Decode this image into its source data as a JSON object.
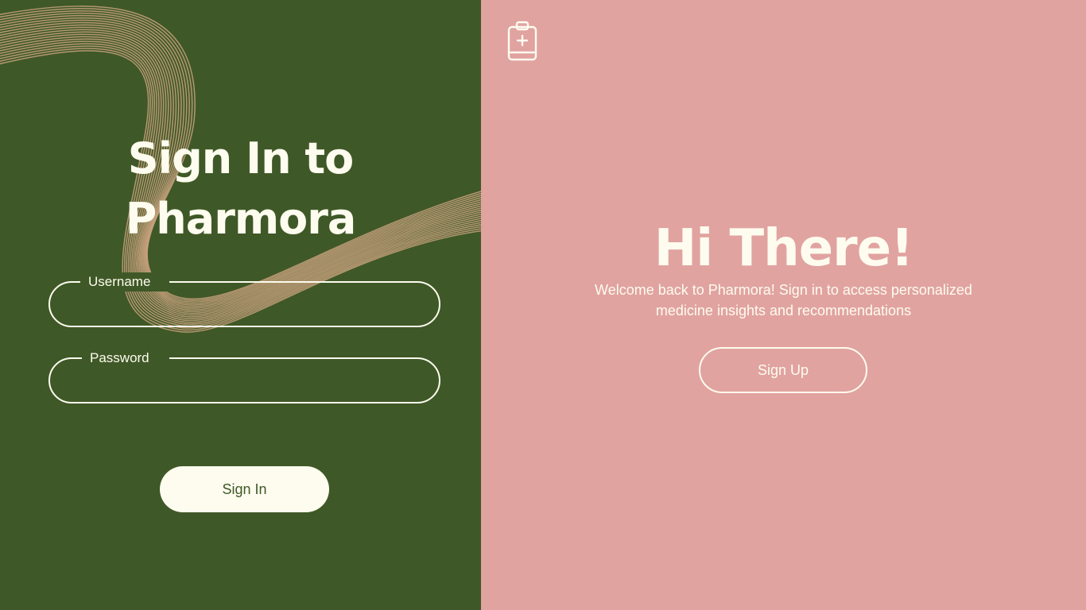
{
  "colors": {
    "left_background": "#3f5827",
    "right_background": "#e1a3a0",
    "text_light": "#fdfcef",
    "wave_lines": "#c9a27f"
  },
  "signin_panel": {
    "title_line1": "Sign In to",
    "title_line2": "Pharmora",
    "username": {
      "label": "Username",
      "value": "",
      "placeholder": ""
    },
    "password": {
      "label": "Password",
      "value": "",
      "placeholder": ""
    },
    "signin_label": "Sign In"
  },
  "welcome_panel": {
    "logo_icon": "clipboard-medical-icon",
    "heading": "Hi There!",
    "text_line1": "Welcome back to Pharmora! Sign in to access personalized",
    "text_line2": "medicine insights and recommendations",
    "signup_label": "Sign Up"
  }
}
